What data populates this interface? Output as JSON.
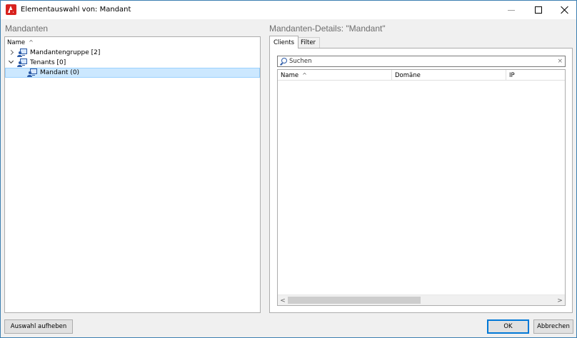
{
  "window": {
    "title": "Elementauswahl von: Mandant"
  },
  "left_panel": {
    "header": "Mandanten",
    "column_header": "Name",
    "tree": [
      {
        "label": "Mandantengruppe [2]",
        "expanded": false,
        "selected": false,
        "icon": "tenant-group-icon"
      },
      {
        "label": "Tenants [0]",
        "expanded": true,
        "selected": false,
        "icon": "tenant-group-icon"
      },
      {
        "label": "Mandant (0)",
        "expanded": false,
        "selected": true,
        "icon": "tenant-icon"
      }
    ]
  },
  "right_panel": {
    "header": "Mandanten-Details: \"Mandant\"",
    "tabs": [
      {
        "label": "Clients",
        "active": true
      },
      {
        "label": "Filter",
        "active": false
      }
    ],
    "search": {
      "placeholder": "Suchen",
      "value": ""
    },
    "grid": {
      "columns": [
        "Name",
        "Domäne",
        "IP"
      ],
      "rows": []
    }
  },
  "buttons": {
    "clear_selection": "Auswahl aufheben",
    "ok": "OK",
    "cancel": "Abbrechen"
  },
  "colors": {
    "selection_bg": "#cce8ff",
    "selection_border": "#99d1ff",
    "accent": "#0078d7",
    "app_icon": "#d8231f"
  }
}
